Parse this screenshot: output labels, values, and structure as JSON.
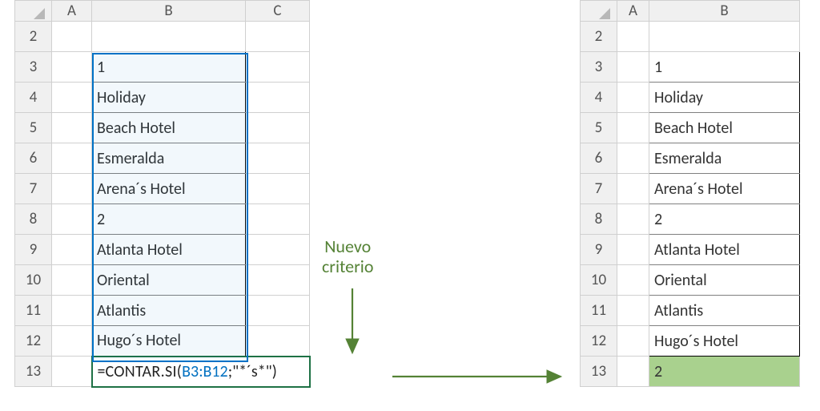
{
  "left": {
    "cols": [
      "A",
      "B",
      "C"
    ],
    "rows": [
      "2",
      "3",
      "4",
      "5",
      "6",
      "7",
      "8",
      "9",
      "10",
      "11",
      "12",
      "13"
    ],
    "values": {
      "3": "1",
      "4": "Holiday",
      "5": "Beach Hotel",
      "6": "Esmeralda",
      "7": "Arena´s Hotel",
      "8": "2",
      "9": "Atlanta Hotel",
      "10": "Oriental",
      "11": "Atlantis",
      "12": "Hugo´s Hotel"
    },
    "formula": {
      "eq": "=",
      "func": "CONTAR.SI(",
      "ref": "B3:B12",
      "sep": ";",
      "crit": "\"*´s*\"",
      "close": ")"
    },
    "selection": "B3:B12"
  },
  "right": {
    "cols": [
      "A",
      "B"
    ],
    "rows": [
      "2",
      "3",
      "4",
      "5",
      "6",
      "7",
      "8",
      "9",
      "10",
      "11",
      "12",
      "13"
    ],
    "values": {
      "3": "1",
      "4": "Holiday",
      "5": "Beach Hotel",
      "6": "Esmeralda",
      "7": "Arena´s Hotel",
      "8": "2",
      "9": "Atlanta Hotel",
      "10": "Oriental",
      "11": "Atlantis",
      "12": "Hugo´s Hotel",
      "13": "2"
    }
  },
  "annotation": {
    "line1": "Nuevo",
    "line2": "criterio"
  },
  "colors": {
    "excel_blue": "#0072C6",
    "olive": "#548235",
    "result_fill": "#A9D18E"
  },
  "chart_data": {
    "type": "table",
    "description": "Two Excel snippets showing a COUNTIF (CONTAR.SI) with wildcard criterion and its result.",
    "left_range": "B3:B12",
    "criterion": "*´s*",
    "result": 2
  }
}
